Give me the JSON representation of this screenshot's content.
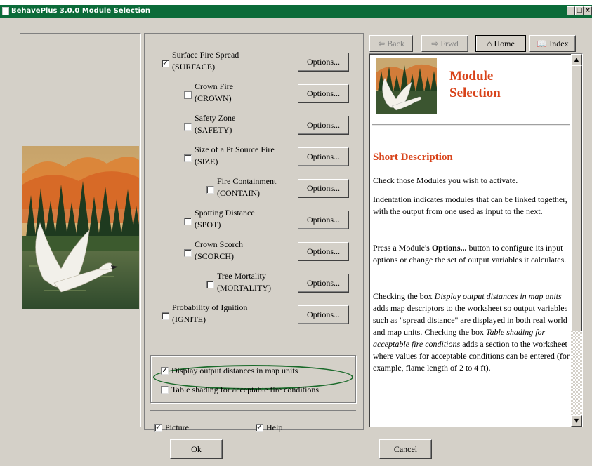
{
  "window": {
    "title": "BehavePlus 3.0.0 Module Selection",
    "min": "_",
    "max": "□",
    "close": "×"
  },
  "modules": [
    {
      "name": "Surface Fire Spread",
      "code": "(SURFACE)",
      "checked": true,
      "options_label": "Options..."
    },
    {
      "name": "Crown Fire",
      "code": "(CROWN)",
      "checked": false,
      "options_label": "Options..."
    },
    {
      "name": "Safety Zone",
      "code": "(SAFETY)",
      "checked": false,
      "options_label": "Options..."
    },
    {
      "name": "Size of a Pt Source Fire",
      "code": "(SIZE)",
      "checked": false,
      "options_label": "Options..."
    },
    {
      "name": "Fire Containment",
      "code": "(CONTAIN)",
      "checked": false,
      "options_label": "Options..."
    },
    {
      "name": "Spotting Distance",
      "code": "(SPOT)",
      "checked": false,
      "options_label": "Options..."
    },
    {
      "name": "Crown Scorch",
      "code": "(SCORCH)",
      "checked": false,
      "options_label": "Options..."
    },
    {
      "name": "Tree Mortality",
      "code": "(MORTALITY)",
      "checked": false,
      "options_label": "Options..."
    },
    {
      "name": "Probability of Ignition",
      "code": "(IGNITE)",
      "checked": false,
      "options_label": "Options..."
    }
  ],
  "display_options": {
    "map_units": {
      "label": "Display output distances in map units",
      "checked": true
    },
    "table_shading": {
      "label": "Table shading for acceptable fire conditions",
      "checked": false
    }
  },
  "view": {
    "picture": {
      "label": "Picture",
      "checked": true
    },
    "help": {
      "label": "Help",
      "checked": true
    }
  },
  "help_nav": {
    "back": "Back",
    "forward": "Frwd",
    "home": "Home",
    "index": "Index"
  },
  "help": {
    "title_line1": "Module",
    "title_line2": "Selection",
    "section": "Short Description",
    "p1": "Check those Modules you wish to activate.",
    "p2": "Indentation indicates modules that can be linked together, with the output from one used as input to the next.",
    "p3_a": "Press a Module's ",
    "p3_b": "Options...",
    "p3_c": " button to configure its input options or change the set of output variables it calculates.",
    "p4_a": "Checking the box ",
    "p4_b": "Display output distances in map units",
    "p4_c": " adds map descriptors to the worksheet so output variables such as \"spread distance\" are displayed in both real world and map units. Checking the box ",
    "p4_d": "Table shading for acceptable fire conditions",
    "p4_e": " adds a section to the worksheet where values for acceptable conditions can be entered (for example, flame length of 2 to 4 ft)."
  },
  "buttons": {
    "ok": "Ok",
    "cancel": "Cancel"
  },
  "colors": {
    "titlebar": "#0b6b39",
    "help_heading": "#d8431a",
    "highlight_ellipse": "#1a6a2a"
  }
}
